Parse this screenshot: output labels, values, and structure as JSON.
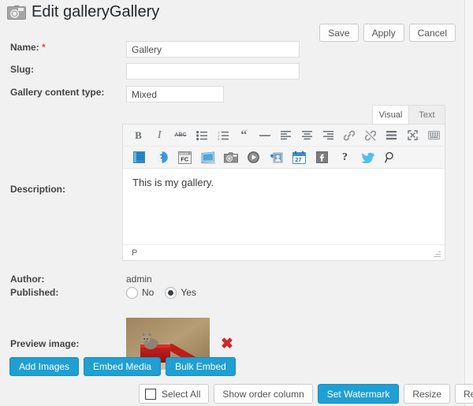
{
  "header": {
    "icon": "camera-icon",
    "title": "Edit galleryGallery"
  },
  "top_buttons": [
    {
      "label": "Save",
      "name": "save-button"
    },
    {
      "label": "Apply",
      "name": "apply-button"
    },
    {
      "label": "Cancel",
      "name": "cancel-button"
    }
  ],
  "form": {
    "name": {
      "label": "Name:",
      "required_marker": "*",
      "value": "Gallery",
      "placeholder": ""
    },
    "slug": {
      "label": "Slug:",
      "value": "",
      "placeholder": ""
    },
    "content_type": {
      "label": "Gallery content type:",
      "value": "Mixed",
      "placeholder": ""
    },
    "description": {
      "label": "Description:",
      "body_text": "This is my gallery.",
      "status_path": "P"
    },
    "author": {
      "label": "Author:",
      "value": "admin"
    },
    "published": {
      "label": "Published:",
      "option_no": "No",
      "option_yes": "Yes",
      "selected": "Yes"
    },
    "preview_image": {
      "label": "Preview image:",
      "alt": "kitten sitting in a red gift box against a tan wall",
      "delete_glyph": "✖"
    }
  },
  "editor": {
    "tabs": [
      {
        "label": "Visual",
        "active": true
      },
      {
        "label": "Text",
        "active": false
      }
    ],
    "toolbar_row1": [
      "bold-icon",
      "italic-icon",
      "strikethrough-icon",
      "unordered-list-icon",
      "ordered-list-icon",
      "blockquote-icon",
      "horizontal-rule-icon",
      "align-left-icon",
      "align-center-icon",
      "align-right-icon",
      "insert-link-icon",
      "unlink-icon",
      "insert-more-tag-icon",
      "fullscreen-icon",
      "toolbar-toggle-icon"
    ],
    "toolbar_row2": [
      "blue-book-icon",
      "moon-contact-icon",
      "fc-box-icon",
      "slideshow-icon",
      "camera-gallery-icon",
      "play-circle-icon",
      "person-photo-icon",
      "calendar-27-icon",
      "facebook-icon",
      "help-question-icon",
      "twitter-icon",
      "search-magnifier-icon"
    ]
  },
  "media_buttons": [
    {
      "label": "Add Images",
      "name": "add-images-button"
    },
    {
      "label": "Embed Media",
      "name": "embed-media-button"
    },
    {
      "label": "Bulk Embed",
      "name": "bulk-embed-button"
    }
  ],
  "bottom_toolbar": [
    {
      "label": "Select All",
      "name": "select-all-button",
      "has_checkbox": true,
      "style": "white"
    },
    {
      "label": "Show order column",
      "name": "show-order-column-button",
      "style": "white"
    },
    {
      "label": "Set Watermark",
      "name": "set-watermark-button",
      "style": "blue"
    },
    {
      "label": "Resize",
      "name": "resize-button",
      "style": "white"
    },
    {
      "label": "Recreate Thumbn",
      "name": "recreate-thumbnails-button",
      "style": "white"
    }
  ],
  "colors": {
    "page_background": "#f1f1f1",
    "accent_blue": "#1f9fd4",
    "required_red": "#d94f43",
    "delete_red": "#d5252a",
    "title_text": "#23282d",
    "label_text": "#444444"
  }
}
